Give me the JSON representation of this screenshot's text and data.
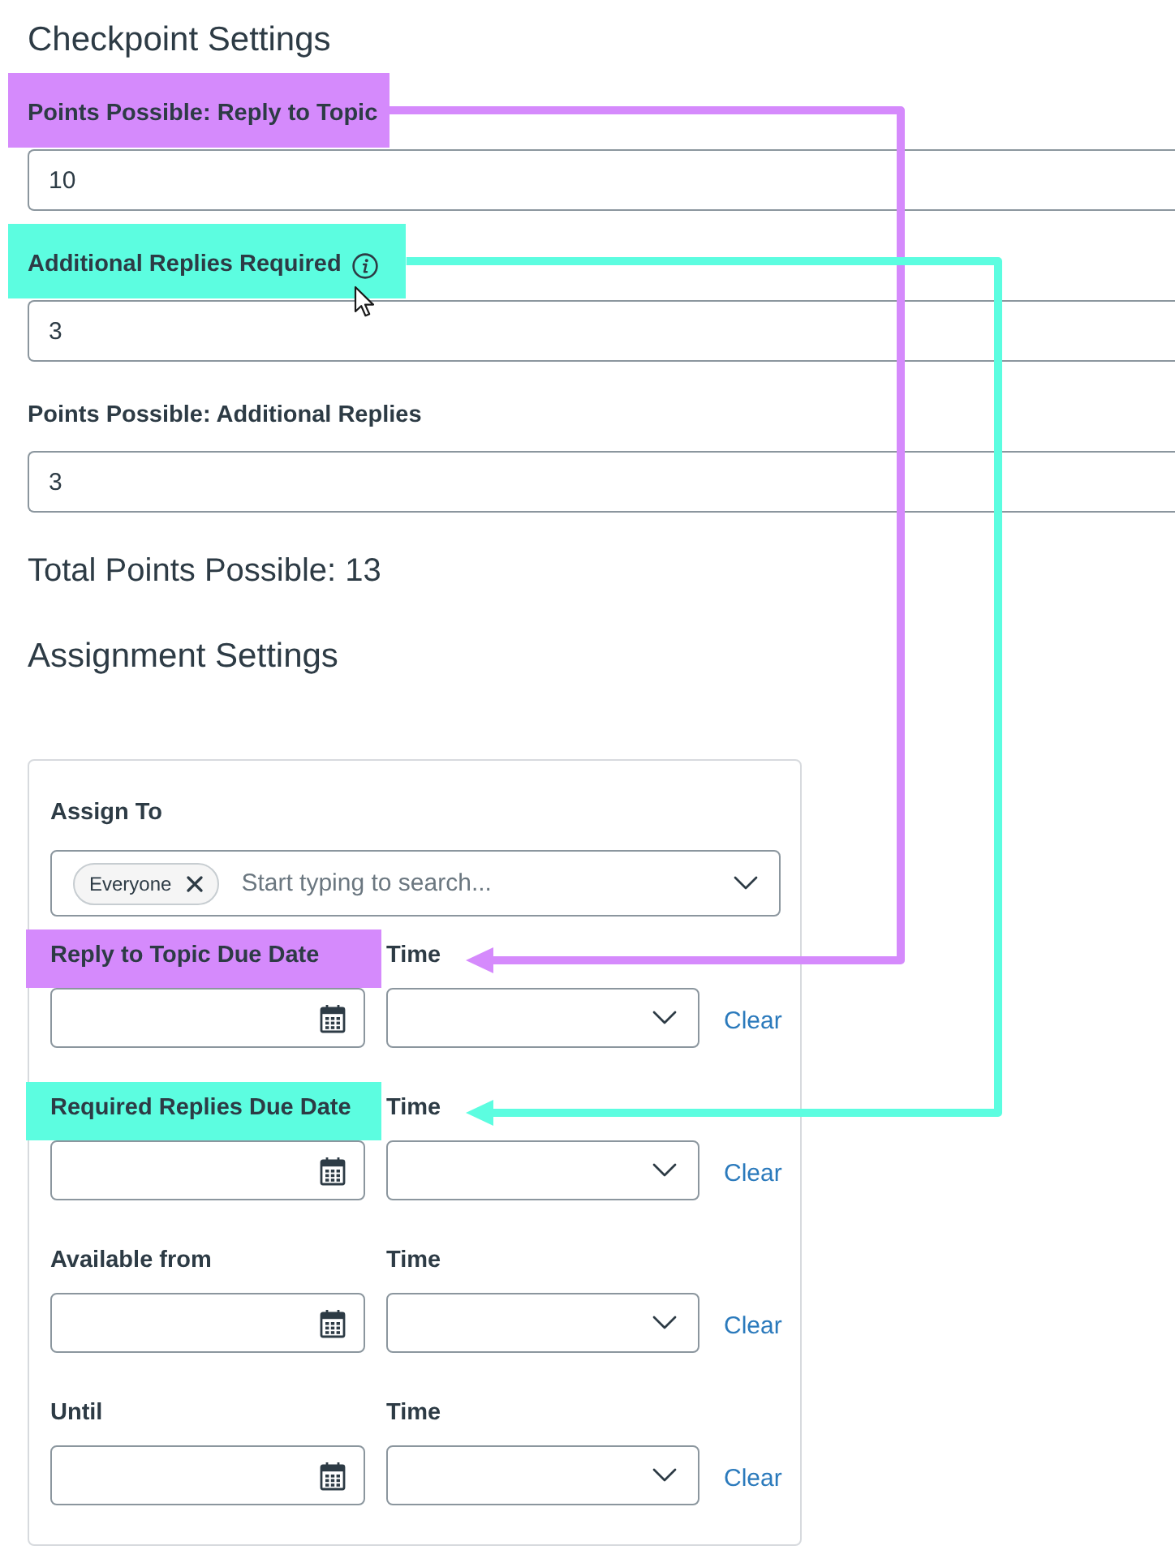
{
  "checkpoint_settings": {
    "title": "Checkpoint Settings",
    "fields": [
      {
        "label": "Points Possible: Reply to Topic",
        "info_icon": false,
        "hovered": false,
        "value": "10",
        "color": "#d58afc"
      },
      {
        "label": "Additional Replies Required",
        "info_icon": true,
        "hovered": true,
        "value": "3",
        "color": "#5cfde0"
      },
      {
        "label": "Points Possible: Additional Replies",
        "info_icon": false,
        "hovered": false,
        "value": "3"
      }
    ]
  },
  "total_points": "Total Points Possible: 13",
  "assignment_settings": {
    "title": "Assignment Settings",
    "assign_to": {
      "label": "Assign To",
      "chips": [
        "Everyone"
      ],
      "placeholder": "Start typing to search..."
    },
    "date_rows": [
      {
        "label": "Reply to Topic Due Date",
        "time_label": "Time",
        "clear": "Clear",
        "color": "#d58afc"
      },
      {
        "label": "Required Replies Due Date",
        "time_label": "Time",
        "clear": "Clear",
        "color": "#5cfde0"
      },
      {
        "label": "Available from",
        "time_label": "Time",
        "clear": "Clear"
      },
      {
        "label": "Until",
        "time_label": "Time",
        "clear": "Clear"
      }
    ]
  }
}
